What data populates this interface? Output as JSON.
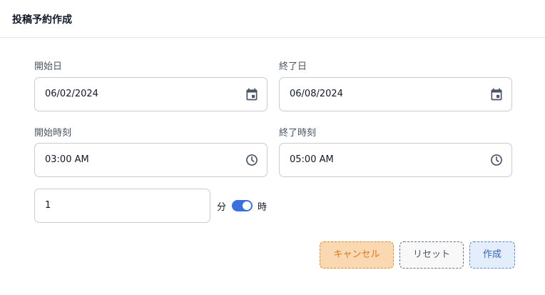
{
  "dialog": {
    "title": "投稿予約作成"
  },
  "form": {
    "start_date": {
      "label": "開始日",
      "value": "06/02/2024",
      "icon": "calendar-icon"
    },
    "end_date": {
      "label": "終了日",
      "value": "06/08/2024",
      "icon": "calendar-icon"
    },
    "start_time": {
      "label": "開始時刻",
      "value": "03:00 AM",
      "icon": "clock-icon"
    },
    "end_time": {
      "label": "終了時刻",
      "value": "05:00 AM",
      "icon": "clock-icon"
    },
    "interval": {
      "value": "1",
      "unit_minutes": "分",
      "unit_hours": "時",
      "toggle_on": true
    }
  },
  "actions": {
    "cancel_label": "キャンセル",
    "reset_label": "リセット",
    "create_label": "作成"
  },
  "colors": {
    "accent": "#3b6fe0",
    "cancel_bg": "#fad9b2",
    "cancel_text": "#d9781f",
    "create_bg": "#e4edfb",
    "create_text": "#3562b8"
  }
}
